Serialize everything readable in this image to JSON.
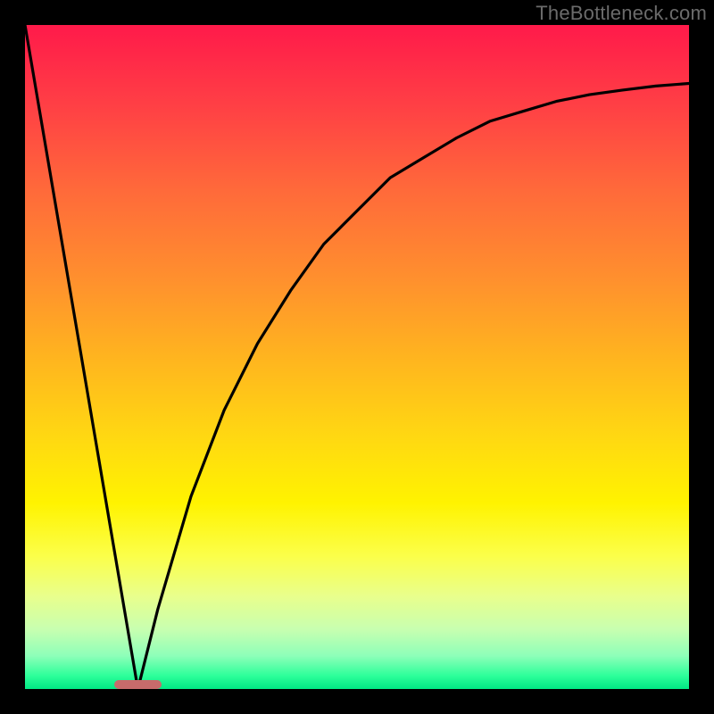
{
  "watermark": "TheBottleneck.com",
  "colors": {
    "frame": "#000000",
    "pill": "#c76b6b",
    "curve": "#000000",
    "watermark": "#6b6b6b"
  },
  "chart_data": {
    "type": "line",
    "title": "",
    "xlabel": "",
    "ylabel": "",
    "xlim": [
      0,
      100
    ],
    "ylim": [
      0,
      100
    ],
    "legend": false,
    "grid": false,
    "annotations": [
      {
        "name": "optimal-marker-pill",
        "x": 17,
        "y": 0,
        "width": 7,
        "height": 1.4
      }
    ],
    "series": [
      {
        "name": "left-linear-drop",
        "x": [
          0,
          17
        ],
        "values": [
          100,
          0
        ]
      },
      {
        "name": "right-saturating-rise",
        "x": [
          17,
          20,
          25,
          30,
          35,
          40,
          45,
          50,
          55,
          60,
          65,
          70,
          75,
          80,
          85,
          90,
          95,
          100
        ],
        "values": [
          0,
          12,
          29,
          42,
          52,
          60,
          67,
          72,
          77,
          80,
          83,
          85.5,
          87,
          88.5,
          89.5,
          90.2,
          90.8,
          91.2
        ]
      }
    ]
  }
}
